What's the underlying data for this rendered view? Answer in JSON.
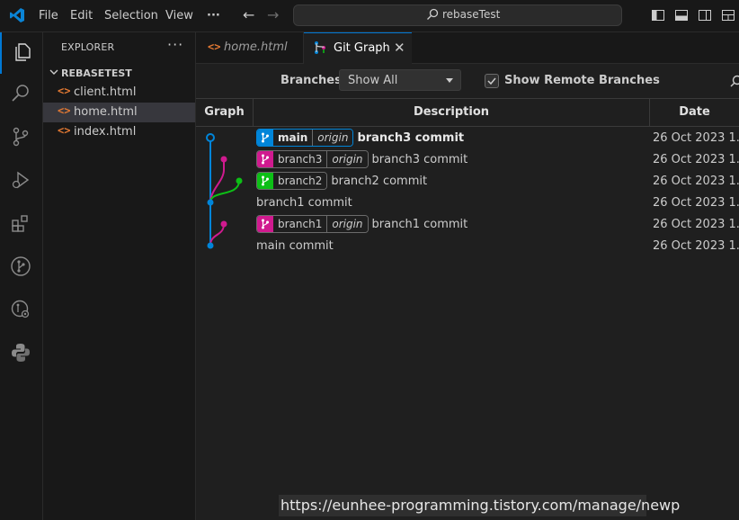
{
  "titlebar": {
    "menu": [
      "File",
      "Edit",
      "Selection",
      "View"
    ],
    "more": "···",
    "search_text": "rebaseTest"
  },
  "explorer": {
    "title": "EXPLORER",
    "more": "···",
    "folder": "REBASETEST",
    "files": [
      {
        "name": "client.html",
        "icon": "<>",
        "selected": false
      },
      {
        "name": "home.html",
        "icon": "<>",
        "selected": true
      },
      {
        "name": "index.html",
        "icon": "<>",
        "selected": false
      }
    ]
  },
  "tabs": [
    {
      "label": "home.html",
      "icon": "<>",
      "active": false
    },
    {
      "label": "Git Graph",
      "icon": "git-graph-icon",
      "active": true,
      "close": "✕"
    }
  ],
  "gitgraph": {
    "branches_label": "Branches:",
    "branches_value": "Show All",
    "show_remote_label": "Show Remote Branches",
    "show_remote_checked": true,
    "columns": {
      "graph": "Graph",
      "description": "Description",
      "date": "Date"
    },
    "commits": [
      {
        "message": "branch3 commit",
        "bold": true,
        "refs": [
          {
            "name": "main",
            "remote": "origin",
            "color": "#0085d9"
          }
        ],
        "date": "26 Oct 2023 1..."
      },
      {
        "message": "branch3 commit",
        "bold": false,
        "refs": [
          {
            "name": "branch3",
            "remote": "origin",
            "color": "#d01a8f"
          }
        ],
        "date": "26 Oct 2023 1..."
      },
      {
        "message": "branch2 commit",
        "bold": false,
        "refs": [
          {
            "name": "branch2",
            "remote": "",
            "color": "#0dbf16"
          }
        ],
        "date": "26 Oct 2023 1..."
      },
      {
        "message": "branch1 commit",
        "bold": false,
        "refs": [],
        "date": "26 Oct 2023 1..."
      },
      {
        "message": "branch1 commit",
        "bold": false,
        "refs": [
          {
            "name": "branch1",
            "remote": "origin",
            "color": "#d01a8f"
          }
        ],
        "date": "26 Oct 2023 1..."
      },
      {
        "message": "main commit",
        "bold": false,
        "refs": [],
        "date": "26 Oct 2023 1..."
      }
    ]
  },
  "overlay": {
    "url": "https://eunhee-programming.tistory.com/manage/newp"
  },
  "colors": {
    "accent": "#0078d4",
    "main": "#0085d9",
    "magenta": "#d01a8f",
    "green": "#0dbf16"
  }
}
